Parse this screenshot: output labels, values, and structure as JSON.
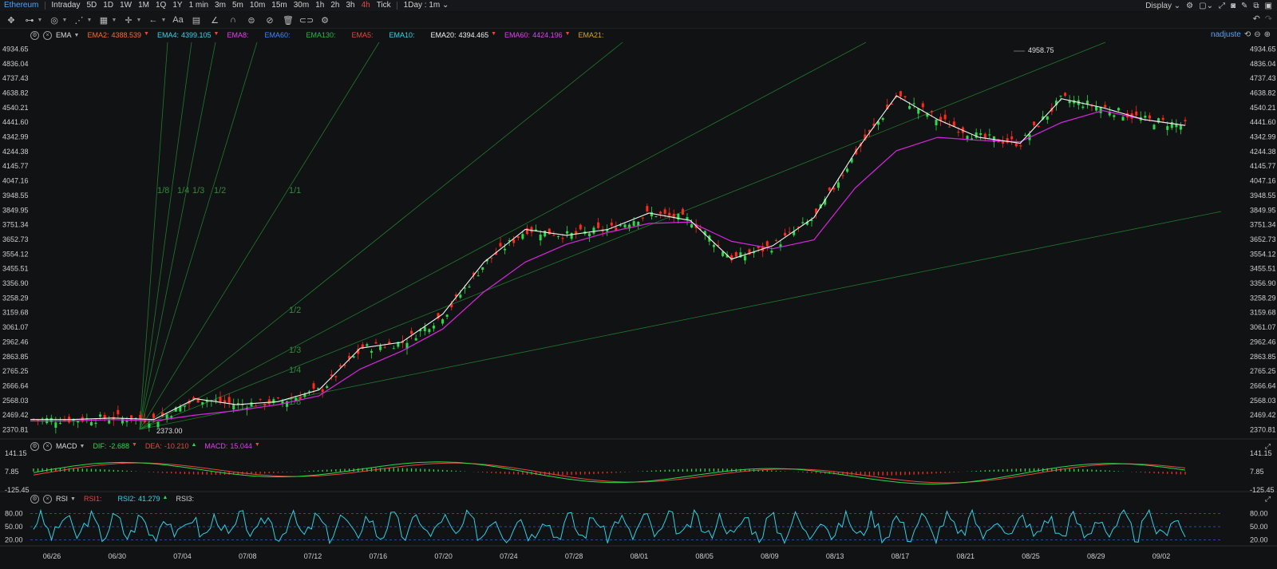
{
  "topbar": {
    "symbol": "Ethereum",
    "periods": [
      "Intraday",
      "5D",
      "1D",
      "1W",
      "1M",
      "1Q",
      "1Y",
      "1 min",
      "3m",
      "5m",
      "10m",
      "15m",
      "30m",
      "1h",
      "2h",
      "3h",
      "4h",
      "Tick"
    ],
    "active_period": "4h",
    "range_selector": "1Day : 1m",
    "display_label": "Display"
  },
  "toolbar": {
    "tools": [
      "move-icon",
      "line-tool-icon",
      "circle-tool-icon",
      "pattern-tool-icon",
      "crosshair-tool-icon",
      "arrow-tool-icon",
      "text-tool-icon",
      "comment-icon",
      "pen-icon",
      "magnet-icon",
      "eye-icon",
      "hide-icon",
      "trash-icon",
      "link-icon",
      "settings-icon"
    ],
    "text_tool_label": "Aa"
  },
  "main_legend": {
    "name": "EMA",
    "items": [
      {
        "label": "EMA2:",
        "value": "4388.539",
        "color": "#ff6a2a",
        "arrow": "▼"
      },
      {
        "label": "EMA4:",
        "value": "4399.105",
        "color": "#3ad2e8",
        "arrow": "▼"
      },
      {
        "label": "EMA8:",
        "value": "",
        "color": "#e83ef2",
        "arrow": ""
      },
      {
        "label": "EMA60:",
        "value": "",
        "color": "#3f86ff",
        "arrow": ""
      },
      {
        "label": "EMA130:",
        "value": "",
        "color": "#2ab84a",
        "arrow": ""
      },
      {
        "label": "EMA5:",
        "value": "",
        "color": "#e8473f",
        "arrow": ""
      },
      {
        "label": "EMA10:",
        "value": "",
        "color": "#3ad2e8",
        "arrow": ""
      },
      {
        "label": "EMA20:",
        "value": "4394.465",
        "color": "#f2f2f2",
        "arrow": "▼"
      },
      {
        "label": "EMA60:",
        "value": "4424.196",
        "color": "#e23ef0",
        "arrow": "▼"
      },
      {
        "label": "EMA21:",
        "value": "",
        "color": "#d4a82a",
        "arrow": ""
      }
    ],
    "adjust_label": "nadjuste"
  },
  "price_axis": [
    "4934.65",
    "4836.04",
    "4737.43",
    "4638.82",
    "4540.21",
    "4441.60",
    "4342.99",
    "4244.38",
    "4145.77",
    "4047.16",
    "3948.55",
    "3849.95",
    "3751.34",
    "3652.73",
    "3554.12",
    "3455.51",
    "3356.90",
    "3258.29",
    "3159.68",
    "3061.07",
    "2962.46",
    "2863.85",
    "2765.25",
    "2666.64",
    "2568.03",
    "2469.42",
    "2370.81"
  ],
  "annotations": {
    "high": "4958.75",
    "low": "2373.00"
  },
  "fan_labels": [
    "1/8",
    "1/4",
    "1/3",
    "1/2",
    "1/1",
    "1/2",
    "1/3",
    "1/4",
    "1/8"
  ],
  "macd_legend": {
    "name": "MACD",
    "items": [
      {
        "label": "DIF:",
        "value": "-2.688",
        "color": "#2bd94a",
        "arrow": "▼"
      },
      {
        "label": "DEA:",
        "value": "-10.210",
        "color": "#e8473f",
        "arrow": "▲"
      },
      {
        "label": "MACD:",
        "value": "15.044",
        "color": "#e23ef0",
        "arrow": "▼"
      }
    ],
    "axis": [
      "141.15",
      "7.85",
      "-125.45"
    ]
  },
  "rsi_legend": {
    "name": "RSI",
    "items": [
      {
        "label": "RSI1:",
        "value": "",
        "color": "#e8473f",
        "arrow": ""
      },
      {
        "label": "RSI2:",
        "value": "41.279",
        "color": "#3ad2e8",
        "arrow": "▲"
      },
      {
        "label": "RSI3:",
        "value": "",
        "color": "#cfcfcf",
        "arrow": ""
      }
    ],
    "axis": [
      "80.00",
      "50.00",
      "20.00"
    ]
  },
  "date_axis": [
    "06/26",
    "06/30",
    "07/04",
    "07/08",
    "07/12",
    "07/16",
    "07/20",
    "07/24",
    "07/28",
    "08/01",
    "08/05",
    "08/09",
    "08/13",
    "08/17",
    "08/21",
    "08/25",
    "08/29",
    "09/02"
  ],
  "chart_data": {
    "type": "line",
    "title": "",
    "series": [
      {
        "name": "EMA20",
        "values": [
          2440,
          2440,
          2450,
          2440,
          2580,
          2540,
          2560,
          2640,
          2920,
          2960,
          3150,
          3500,
          3720,
          3680,
          3720,
          3830,
          3780,
          3520,
          3610,
          3800,
          4240,
          4620,
          4460,
          4340,
          4300,
          4600,
          4540,
          4460,
          4420
        ]
      },
      {
        "name": "EMA60",
        "values": [
          2430,
          2430,
          2440,
          2430,
          2470,
          2500,
          2540,
          2600,
          2780,
          2900,
          3050,
          3300,
          3500,
          3620,
          3700,
          3760,
          3770,
          3640,
          3590,
          3650,
          4000,
          4250,
          4340,
          4320,
          4310,
          4440,
          4520,
          4460,
          4420
        ]
      }
    ],
    "x_range": [
      "06/25",
      "09/04"
    ],
    "ylim": [
      2320,
      4980
    ],
    "high": 4958.75,
    "low": 2373.0
  },
  "colors": {
    "up": "#2bd94a",
    "down": "#ff2a1a",
    "bg": "#111214"
  }
}
